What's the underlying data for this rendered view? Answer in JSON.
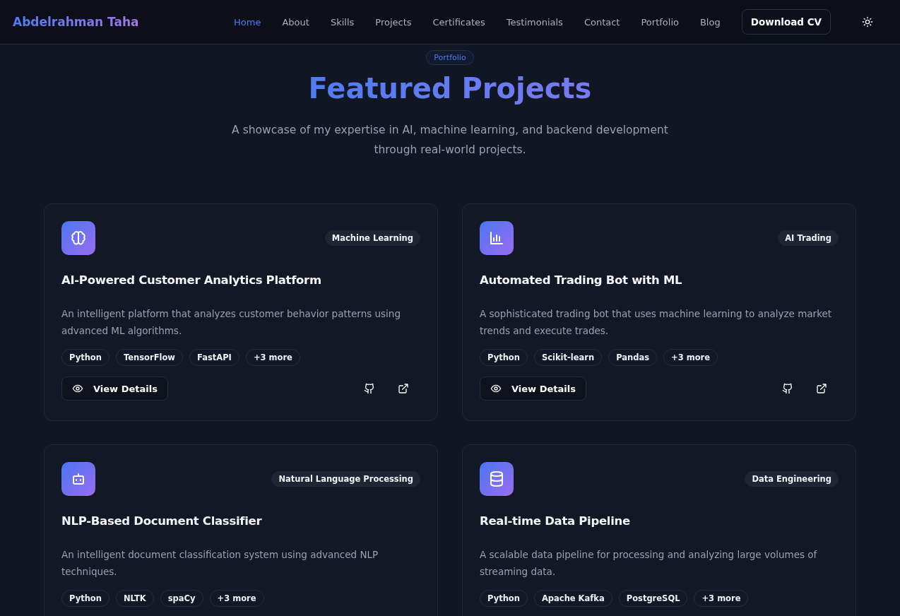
{
  "nav": {
    "brand": "Abdelrahman Taha",
    "links": [
      {
        "label": "Home",
        "selected": true
      },
      {
        "label": "About",
        "selected": false
      },
      {
        "label": "Skills",
        "selected": false
      },
      {
        "label": "Projects",
        "selected": false
      },
      {
        "label": "Certificates",
        "selected": false
      },
      {
        "label": "Testimonials",
        "selected": false
      },
      {
        "label": "Contact",
        "selected": false
      },
      {
        "label": "Portfolio",
        "selected": false
      },
      {
        "label": "Blog",
        "selected": false
      }
    ],
    "cta": "Download CV"
  },
  "section": {
    "badge": "Portfolio",
    "title": "Featured Projects",
    "subtitle": "A showcase of my expertise in AI, machine learning, and backend development through real-world projects."
  },
  "projects": [
    {
      "kind": "brain",
      "category": "Machine Learning",
      "title": "AI-Powered Customer Analytics Platform",
      "description": "An intelligent platform that analyzes customer behavior patterns using advanced ML algorithms.",
      "tags": [
        "Python",
        "TensorFlow",
        "FastAPI",
        "+3 more"
      ],
      "button": "View Details"
    },
    {
      "kind": "chart",
      "category": "AI Trading",
      "title": "Automated Trading Bot with ML",
      "description": "A sophisticated trading bot that uses machine learning to analyze market trends and execute trades.",
      "tags": [
        "Python",
        "Scikit-learn",
        "Pandas",
        "+3 more"
      ],
      "button": "View Details"
    },
    {
      "kind": "bot",
      "category": "Natural Language Processing",
      "title": "NLP-Based Document Classifier",
      "description": "An intelligent document classification system using advanced NLP techniques.",
      "tags": [
        "Python",
        "NLTK",
        "spaCy",
        "+3 more"
      ]
    },
    {
      "kind": "database",
      "category": "Data Engineering",
      "title": "Real-time Data Pipeline",
      "description": "A scalable data pipeline for processing and analyzing large volumes of streaming data.",
      "tags": [
        "Python",
        "Apache Kafka",
        "PostgreSQL",
        "+3 more"
      ]
    }
  ]
}
